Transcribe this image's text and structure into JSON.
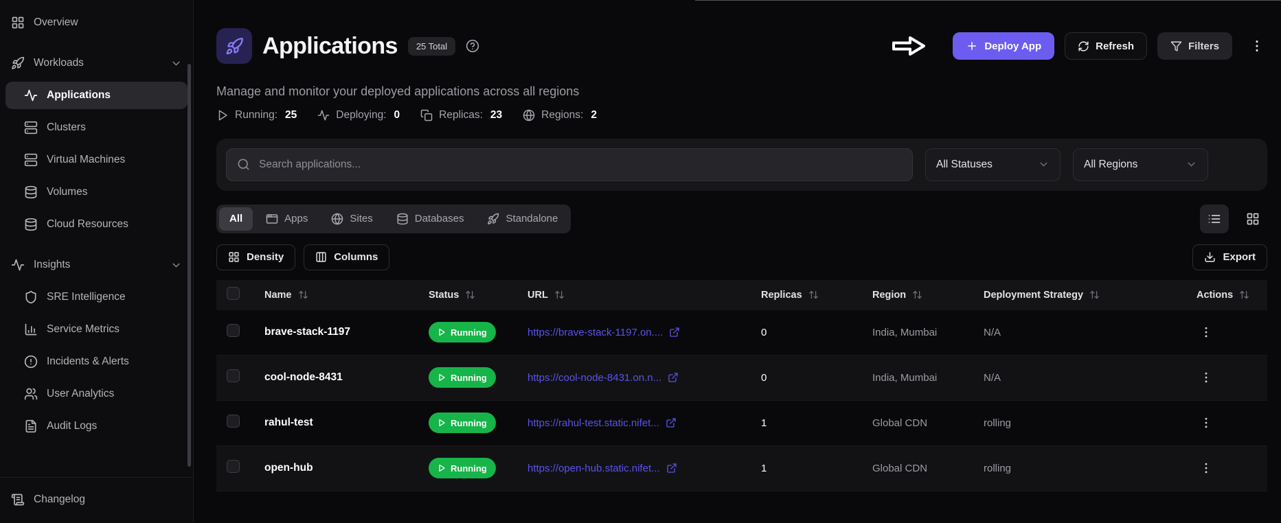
{
  "sidebar": {
    "items": [
      {
        "label": "Overview",
        "icon": "grid",
        "type": "top"
      },
      {
        "label": "Workloads",
        "icon": "rocket",
        "type": "section",
        "chevron": true
      },
      {
        "label": "Applications",
        "icon": "activity",
        "type": "sub",
        "active": true
      },
      {
        "label": "Clusters",
        "icon": "server",
        "type": "sub"
      },
      {
        "label": "Virtual Machines",
        "icon": "server",
        "type": "sub"
      },
      {
        "label": "Volumes",
        "icon": "database",
        "type": "sub"
      },
      {
        "label": "Cloud Resources",
        "icon": "database",
        "type": "sub"
      },
      {
        "label": "Insights",
        "icon": "activity",
        "type": "section",
        "chevron": true
      },
      {
        "label": "SRE Intelligence",
        "icon": "shield",
        "type": "sub"
      },
      {
        "label": "Service Metrics",
        "icon": "bar-chart",
        "type": "sub"
      },
      {
        "label": "Incidents & Alerts",
        "icon": "alert-circle",
        "type": "sub"
      },
      {
        "label": "User Analytics",
        "icon": "users",
        "type": "sub"
      },
      {
        "label": "Audit Logs",
        "icon": "file-text",
        "type": "sub"
      }
    ],
    "footer": {
      "label": "Changelog",
      "icon": "scroll"
    }
  },
  "header": {
    "title": "Applications",
    "total_badge": "25 Total",
    "subtitle": "Manage and monitor your deployed applications across all regions",
    "stats": [
      {
        "icon": "play",
        "label": "Running:",
        "value": "25"
      },
      {
        "icon": "activity",
        "label": "Deploying:",
        "value": "0"
      },
      {
        "icon": "copy",
        "label": "Replicas:",
        "value": "23"
      },
      {
        "icon": "globe",
        "label": "Regions:",
        "value": "2"
      }
    ],
    "actions": {
      "deploy": "Deploy App",
      "refresh": "Refresh",
      "filters": "Filters"
    }
  },
  "search": {
    "placeholder": "Search applications...",
    "status_filter": "All Statuses",
    "region_filter": "All Regions"
  },
  "tabs": [
    {
      "label": "All",
      "icon": null,
      "active": true
    },
    {
      "label": "Apps",
      "icon": "app-window",
      "active": false
    },
    {
      "label": "Sites",
      "icon": "globe",
      "active": false
    },
    {
      "label": "Databases",
      "icon": "database",
      "active": false
    },
    {
      "label": "Standalone",
      "icon": "rocket",
      "active": false
    }
  ],
  "toolbar": {
    "density": "Density",
    "columns": "Columns",
    "export": "Export"
  },
  "table": {
    "columns": [
      "Name",
      "Status",
      "URL",
      "Replicas",
      "Region",
      "Deployment Strategy",
      "Actions"
    ],
    "rows": [
      {
        "name": "brave-stack-1197",
        "status": "Running",
        "url": "https://brave-stack-1197.on....",
        "replicas": "0",
        "region": "India, Mumbai",
        "strategy": "N/A"
      },
      {
        "name": "cool-node-8431",
        "status": "Running",
        "url": "https://cool-node-8431.on.n...",
        "replicas": "0",
        "region": "India, Mumbai",
        "strategy": "N/A"
      },
      {
        "name": "rahul-test",
        "status": "Running",
        "url": "https://rahul-test.static.nifet...",
        "replicas": "1",
        "region": "Global CDN",
        "strategy": "rolling"
      },
      {
        "name": "open-hub",
        "status": "Running",
        "url": "https://open-hub.static.nifet...",
        "replicas": "1",
        "region": "Global CDN",
        "strategy": "rolling"
      }
    ]
  },
  "colors": {
    "accent": "#6d5cf0",
    "running_green": "#17b449",
    "link": "#5b52ea",
    "icon_purple": "#8b7cf6"
  }
}
